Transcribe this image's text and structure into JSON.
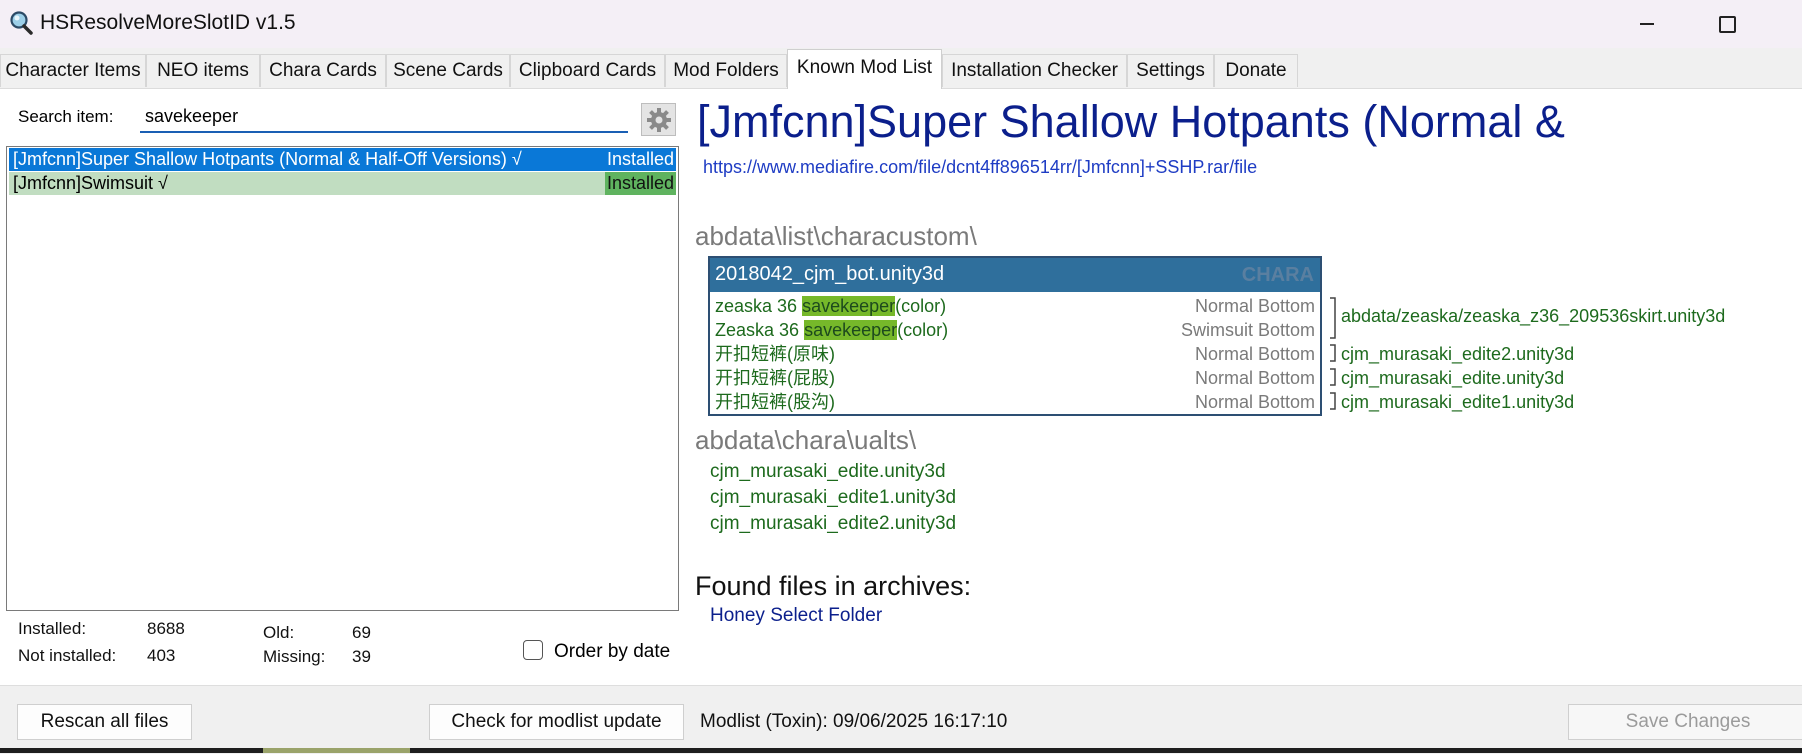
{
  "window": {
    "title": "HSResolveMoreSlotID v1.5"
  },
  "tabs": [
    {
      "label": "Character Items"
    },
    {
      "label": "NEO items"
    },
    {
      "label": "Chara Cards"
    },
    {
      "label": "Scene Cards"
    },
    {
      "label": "Clipboard Cards"
    },
    {
      "label": "Mod Folders"
    },
    {
      "label": "Known Mod List",
      "active": true
    },
    {
      "label": "Installation Checker"
    },
    {
      "label": "Settings"
    },
    {
      "label": "Donate"
    }
  ],
  "search": {
    "label": "Search item:",
    "value": "savekeeper"
  },
  "results": [
    {
      "name": "[Jmfcnn]Super Shallow Hotpants (Normal & Half-Off Versions) √",
      "status": "Installed",
      "selected": true
    },
    {
      "name": "[Jmfcnn]Swimsuit √",
      "status": "Installed",
      "selected": false
    }
  ],
  "stats": {
    "installed_label": "Installed:",
    "installed_value": "8688",
    "not_installed_label": "Not installed:",
    "not_installed_value": "403",
    "old_label": "Old:",
    "old_value": "69",
    "missing_label": "Missing:",
    "missing_value": "39"
  },
  "order_by_date": {
    "label": "Order by date",
    "checked": false
  },
  "detail": {
    "title": "[Jmfcnn]Super Shallow Hotpants (Normal &",
    "link": "https://www.mediafire.com/file/dcnt4ff896514rr/[Jmfcnn]+SSHP.rar/file",
    "section1": "abdata\\list\\characustom\\",
    "file_box": {
      "name": "2018042_cjm_bot.unity3d",
      "tag": "CHARA",
      "rows": [
        {
          "prefix": "zeaska 36 ",
          "highlight": "savekeeper",
          "suffix": "(color)",
          "category": "Normal Bottom"
        },
        {
          "prefix": "Zeaska 36 ",
          "highlight": "savekeeper",
          "suffix": "(color)",
          "category": "Swimsuit Bottom"
        },
        {
          "prefix": "开扣短裤(原味)",
          "highlight": "",
          "suffix": "",
          "category": "Normal Bottom"
        },
        {
          "prefix": "开扣短裤(屁股)",
          "highlight": "",
          "suffix": "",
          "category": "Normal Bottom"
        },
        {
          "prefix": "开扣短裤(股沟)",
          "highlight": "",
          "suffix": "",
          "category": "Normal Bottom"
        }
      ]
    },
    "side_paths": [
      "abdata/zeaska/zeaska_z36_209536skirt.unity3d",
      "cjm_murasaki_edite2.unity3d",
      "cjm_murasaki_edite.unity3d",
      "cjm_murasaki_edite1.unity3d"
    ],
    "section2": "abdata\\chara\\ualts\\",
    "ualts_files": [
      "cjm_murasaki_edite.unity3d",
      "cjm_murasaki_edite1.unity3d",
      "cjm_murasaki_edite2.unity3d"
    ],
    "found_heading": "Found files in archives:",
    "found_items": [
      "Honey Select Folder"
    ]
  },
  "bottom": {
    "rescan_label": "Rescan all files",
    "check_label": "Check for modlist update",
    "modlist_info": "Modlist (Toxin): 09/06/2025 16:17:10",
    "save_label": "Save Changes"
  },
  "colors": {
    "accent": "#0a78d7",
    "title_blue": "#0b1f8c",
    "installed_green": "#5fb35f",
    "highlight_green": "#76b82a",
    "file_header": "#2f6f9c"
  },
  "icons": {
    "app": "magnifier-icon",
    "settings": "gear-icon"
  }
}
